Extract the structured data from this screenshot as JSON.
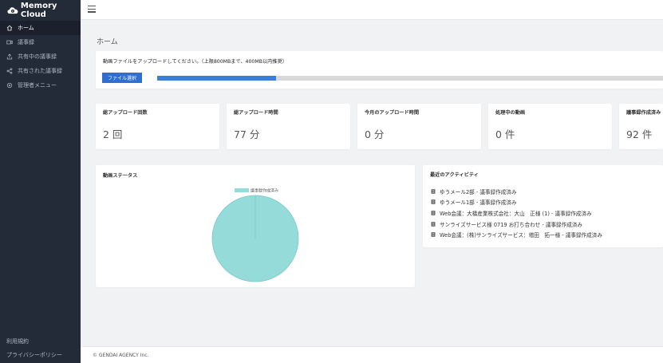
{
  "app": {
    "name": "Memory Cloud"
  },
  "sidebar": {
    "items": [
      {
        "label": "ホーム",
        "icon": "home-icon",
        "active": true
      },
      {
        "label": "議事録",
        "icon": "video-icon"
      },
      {
        "label": "共有中の議事録",
        "icon": "upload-share-icon"
      },
      {
        "label": "共有された議事録",
        "icon": "share-icon"
      },
      {
        "label": "管理者メニュー",
        "icon": "gear-icon"
      }
    ],
    "bottom_links": [
      "利用規約",
      "プライバシーポリシー"
    ]
  },
  "page": {
    "title": "ホーム"
  },
  "upload": {
    "instruction": "動画ファイルをアップロードしてください。（上限800MBまで、400MB以内推奨）",
    "button_label": "ファイル選択",
    "progress": 0.235
  },
  "stats": [
    {
      "label": "総アップロード回数",
      "value": "2 回"
    },
    {
      "label": "総アップロード時間",
      "value": "77 分"
    },
    {
      "label": "今月のアップロード時間",
      "value": "0 分"
    },
    {
      "label": "処理中の動画",
      "value": "0 件"
    },
    {
      "label": "議事録作成済み",
      "value": "92 件"
    }
  ],
  "video_status": {
    "title": "動画ステータス",
    "chart_data": {
      "type": "pie",
      "title": "",
      "legend_position": "top",
      "slices": [
        {
          "name": "議事録作成済み",
          "value": 92,
          "color": "#94dbd9"
        }
      ]
    }
  },
  "activity": {
    "title": "最近のアクティビティ",
    "items": [
      "ゆうメール2部 - 議事録作成済み",
      "ゆうメール1部 - 議事録作成済み",
      "Web会議：大橋産業株式会社：大山　正様 (1) - 議事録作成済み",
      "サンライズサービス様 0719 お打ち合わせ - 議事録作成済み",
      "Web会議：(株)サンライズサービス：増田　拓一様 - 議事録作成済み"
    ]
  },
  "footer": {
    "copyright": "© GENDAI AGENCY Inc."
  }
}
